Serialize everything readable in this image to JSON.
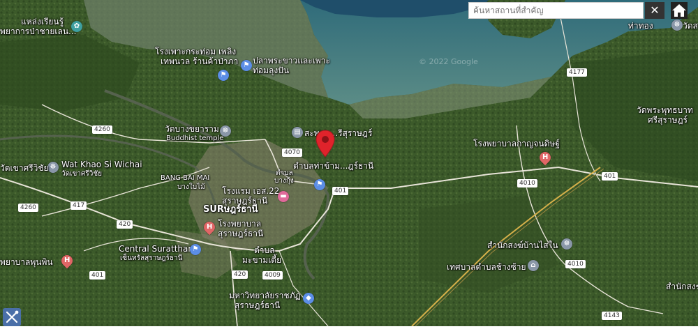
{
  "search": {
    "placeholder": "ค้นหาสถานที่สำคัญ"
  },
  "controls": {
    "close_symbol": "✕"
  },
  "icons": {
    "close": "close-icon",
    "home": "home-icon",
    "tools": "tools-icon",
    "pin": "map-pin-icon"
  },
  "watermark": "© 2022 Google",
  "places": {
    "school": "แหล่งเรียนรู้",
    "school_sub": "พยาการป่าชายเลน...",
    "factory": "โรงเพาะกระท่อม เพลิง",
    "factory2": "เทพนวล ร้านค้าป่าภา",
    "fish": "ปลาพระขาวและเพาะ",
    "fish2": "ท่อมลุงปัน",
    "temple_bangkhayam": "วัดบางขยาราม",
    "temple_bangkhayam_en": "Buddhist temple",
    "sapan": "สะพาน...รีสุราษฎร์",
    "watkhao": "Wat Khao Si Wichai",
    "watkhao_th": "วัดเขาศรีวิชัย",
    "watkhao_left": "วัดเขาศรีวิชัย",
    "bangbaimai": "BANG BAI MAI",
    "bangbaimai_th": "บางใบไม้",
    "tambon_bangkung": "ตำบล",
    "tambon_bangkung2": "บางกุ้ง",
    "amphoe_center": "ตำบลท่าข้าม...ฎร์ธานี",
    "hotel": "โรงแรม เอส.22",
    "hotel2": "สุราษฎร์ธานี",
    "sur": "SURษฎร์ธานี",
    "hosp_city": "โรงพยาบาล",
    "hosp_city2": "สุราษฎร์ธานี",
    "central": "Central Suratthani",
    "central_th": "เซ็นทรัลสุราษฎร์ธานี",
    "hosp_phunphin": "พยาบาลพุนพิน",
    "makham": "ตำบล",
    "makham2": "มะขามเตี้ย",
    "university": "มหาวิทยาลัยราชภัฏ",
    "university2": "สุราษฎร์ธานี",
    "hosp_kanchanadit": "โรงพยาบาลกาญจนดิษฐ์",
    "temple_phuttabat": "วัดพระพุทธบาท",
    "temple_phuttabat2": "ศรีสุราษฎร์",
    "thathong": "ท่าทอง",
    "office_bansainai": "สำนักสงฆ์บ้านไสใน",
    "municipality": "เทศบาลตำบลช้างซ้าย",
    "office_right": "สำนักสงฆ",
    "tambon_right": "วัดส"
  },
  "roads": {
    "r4177": "4177",
    "r4260a": "4260",
    "r4260b": "4260",
    "r4070": "4070",
    "r401a": "401",
    "r401b": "401",
    "r401c": "401",
    "r4010a": "4010",
    "r4010b": "4010",
    "r417": "417",
    "r420a": "420",
    "r420b": "420",
    "r4009": "4009",
    "r4143": "4143"
  }
}
